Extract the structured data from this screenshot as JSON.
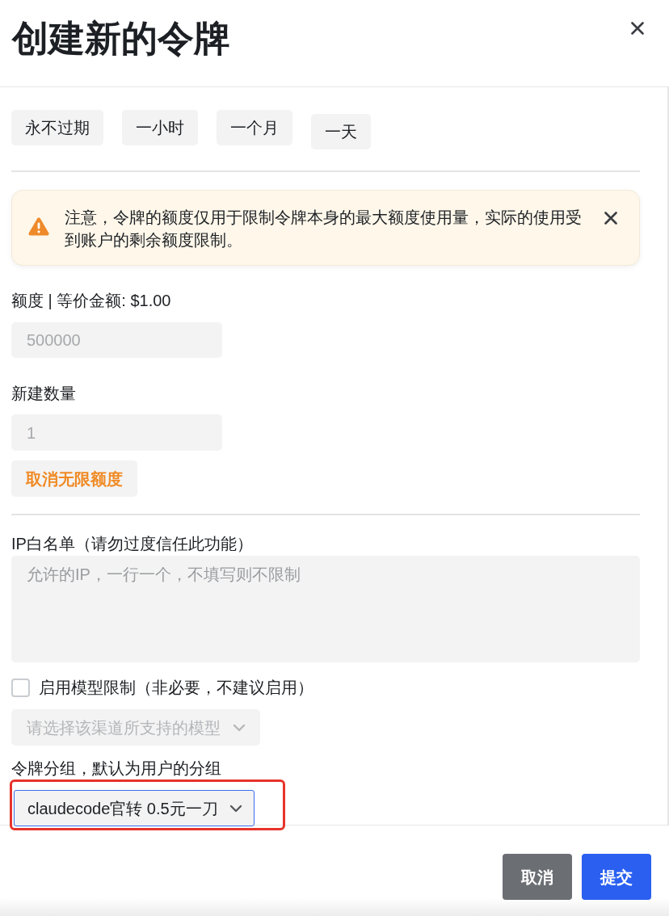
{
  "dialog": {
    "title": "创建新的令牌"
  },
  "expiry_presets": [
    {
      "label": "永不过期"
    },
    {
      "label": "一小时"
    },
    {
      "label": "一个月"
    },
    {
      "label": "一天"
    }
  ],
  "alert": {
    "message": "注意，令牌的额度仅用于限制令牌本身的最大额度使用量，实际的使用受到账户的剩余额度限制。"
  },
  "quota": {
    "label": "额度 | 等价金额: $1.00",
    "value": "500000",
    "disabled": true
  },
  "count": {
    "label": "新建数量",
    "value": "1",
    "disabled": true
  },
  "unlimited_toggle": {
    "label": "取消无限额度"
  },
  "ip_whitelist": {
    "label": "IP白名单（请勿过度信任此功能）",
    "placeholder": "允许的IP，一行一个，不填写则不限制"
  },
  "model_limit": {
    "label": "启用模型限制（非必要，不建议启用）",
    "checked": false
  },
  "model_select": {
    "placeholder": "请选择该渠道所支持的模型",
    "disabled": true
  },
  "group": {
    "label": "令牌分组，默认为用户的分组",
    "value": "claudecode官转 0.5元一刀",
    "highlighted": true
  },
  "footer": {
    "buttons": [
      {
        "label": "取消",
        "kind": "secondary"
      },
      {
        "label": "提交",
        "kind": "primary"
      }
    ]
  }
}
